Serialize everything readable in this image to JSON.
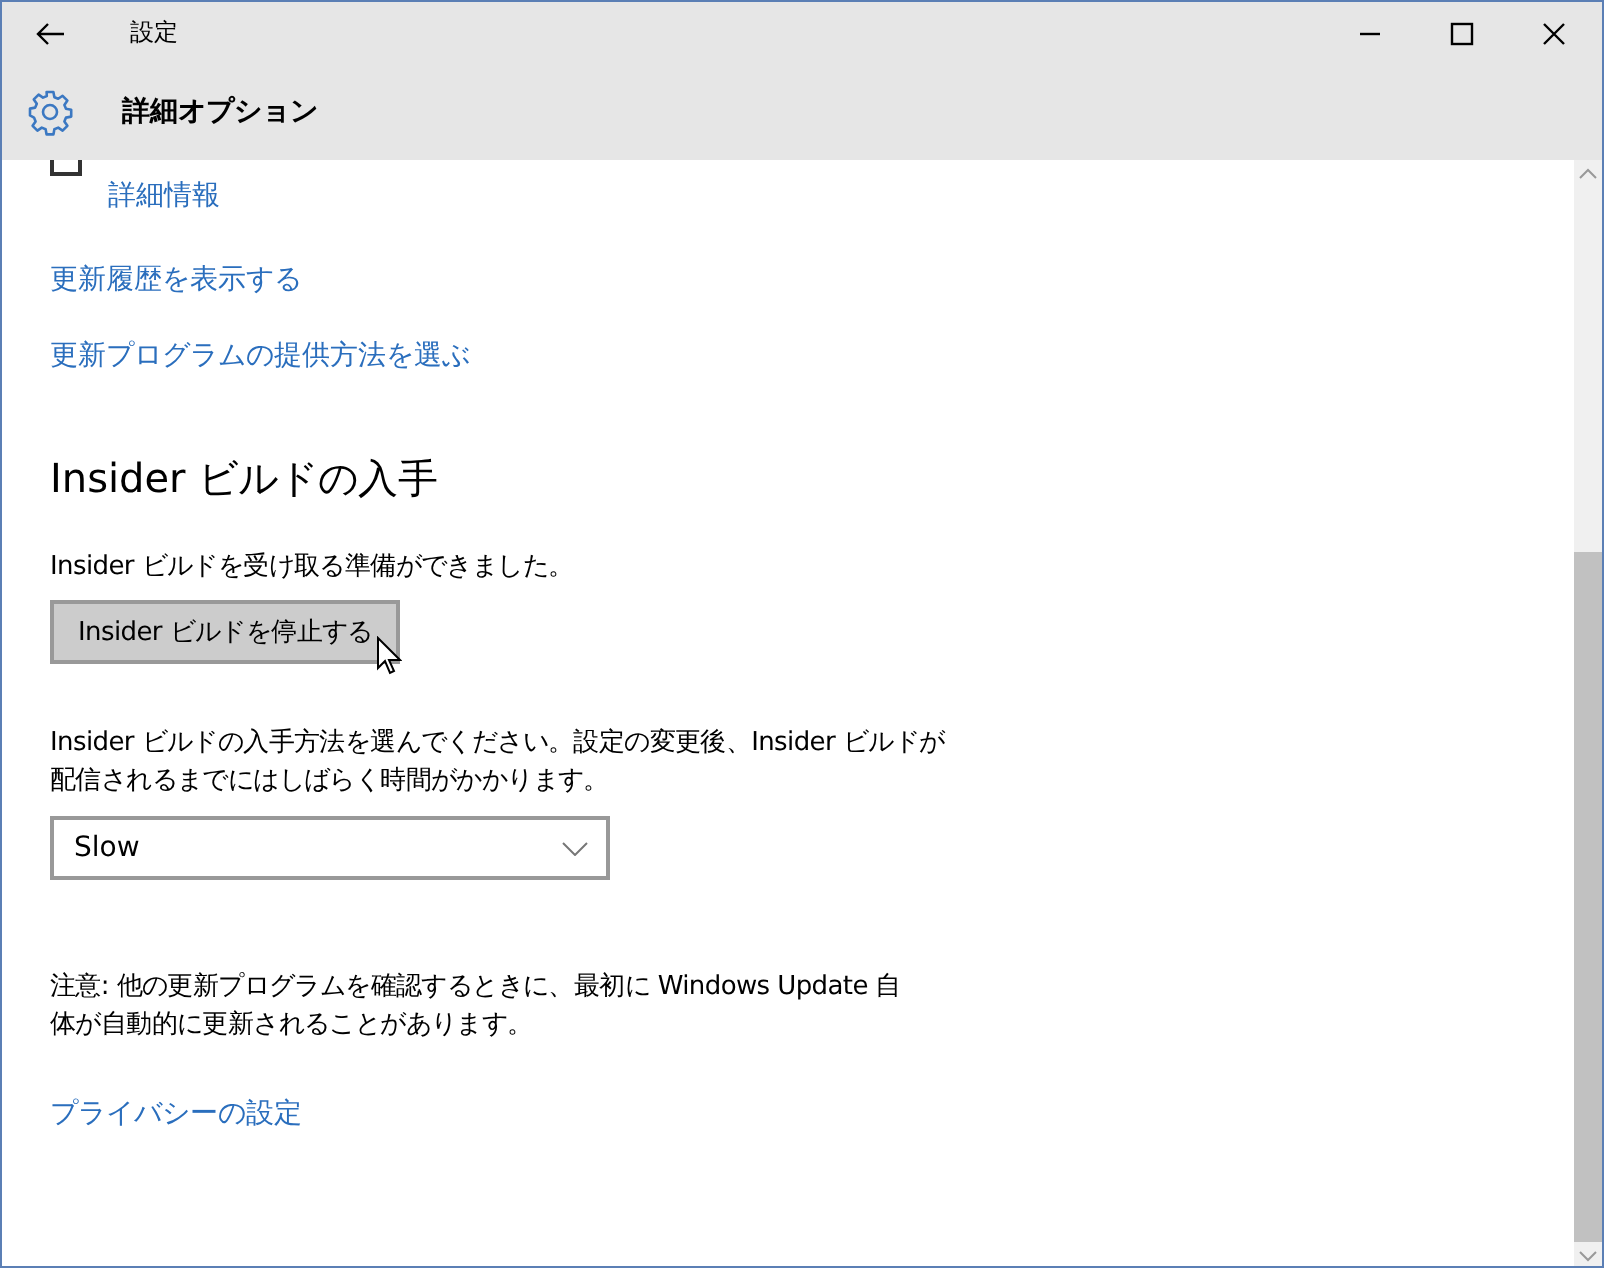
{
  "window": {
    "title": "設定"
  },
  "header": {
    "title": "詳細オプション"
  },
  "top_checkbox": {
    "checked": false
  },
  "links_top": [
    "詳細情報",
    "更新履歴を表示する",
    "更新プログラムの提供方法を選ぶ"
  ],
  "insider": {
    "heading": "Insider ビルドの入手",
    "status": "Insider ビルドを受け取る準備ができました。",
    "button": "Insider ビルドを停止する",
    "description": "Insider ビルドの入手方法を選んでください。設定の変更後、Insider ビルドが配信されるまでにはしばらく時間がかかります。",
    "dropdown": {
      "value": "Slow"
    }
  },
  "note": "注意: 他の更新プログラムを確認するときに、最初に Windows Update 自体が自動的に更新されることがあります。",
  "privacy_link": "プライバシーの設定"
}
